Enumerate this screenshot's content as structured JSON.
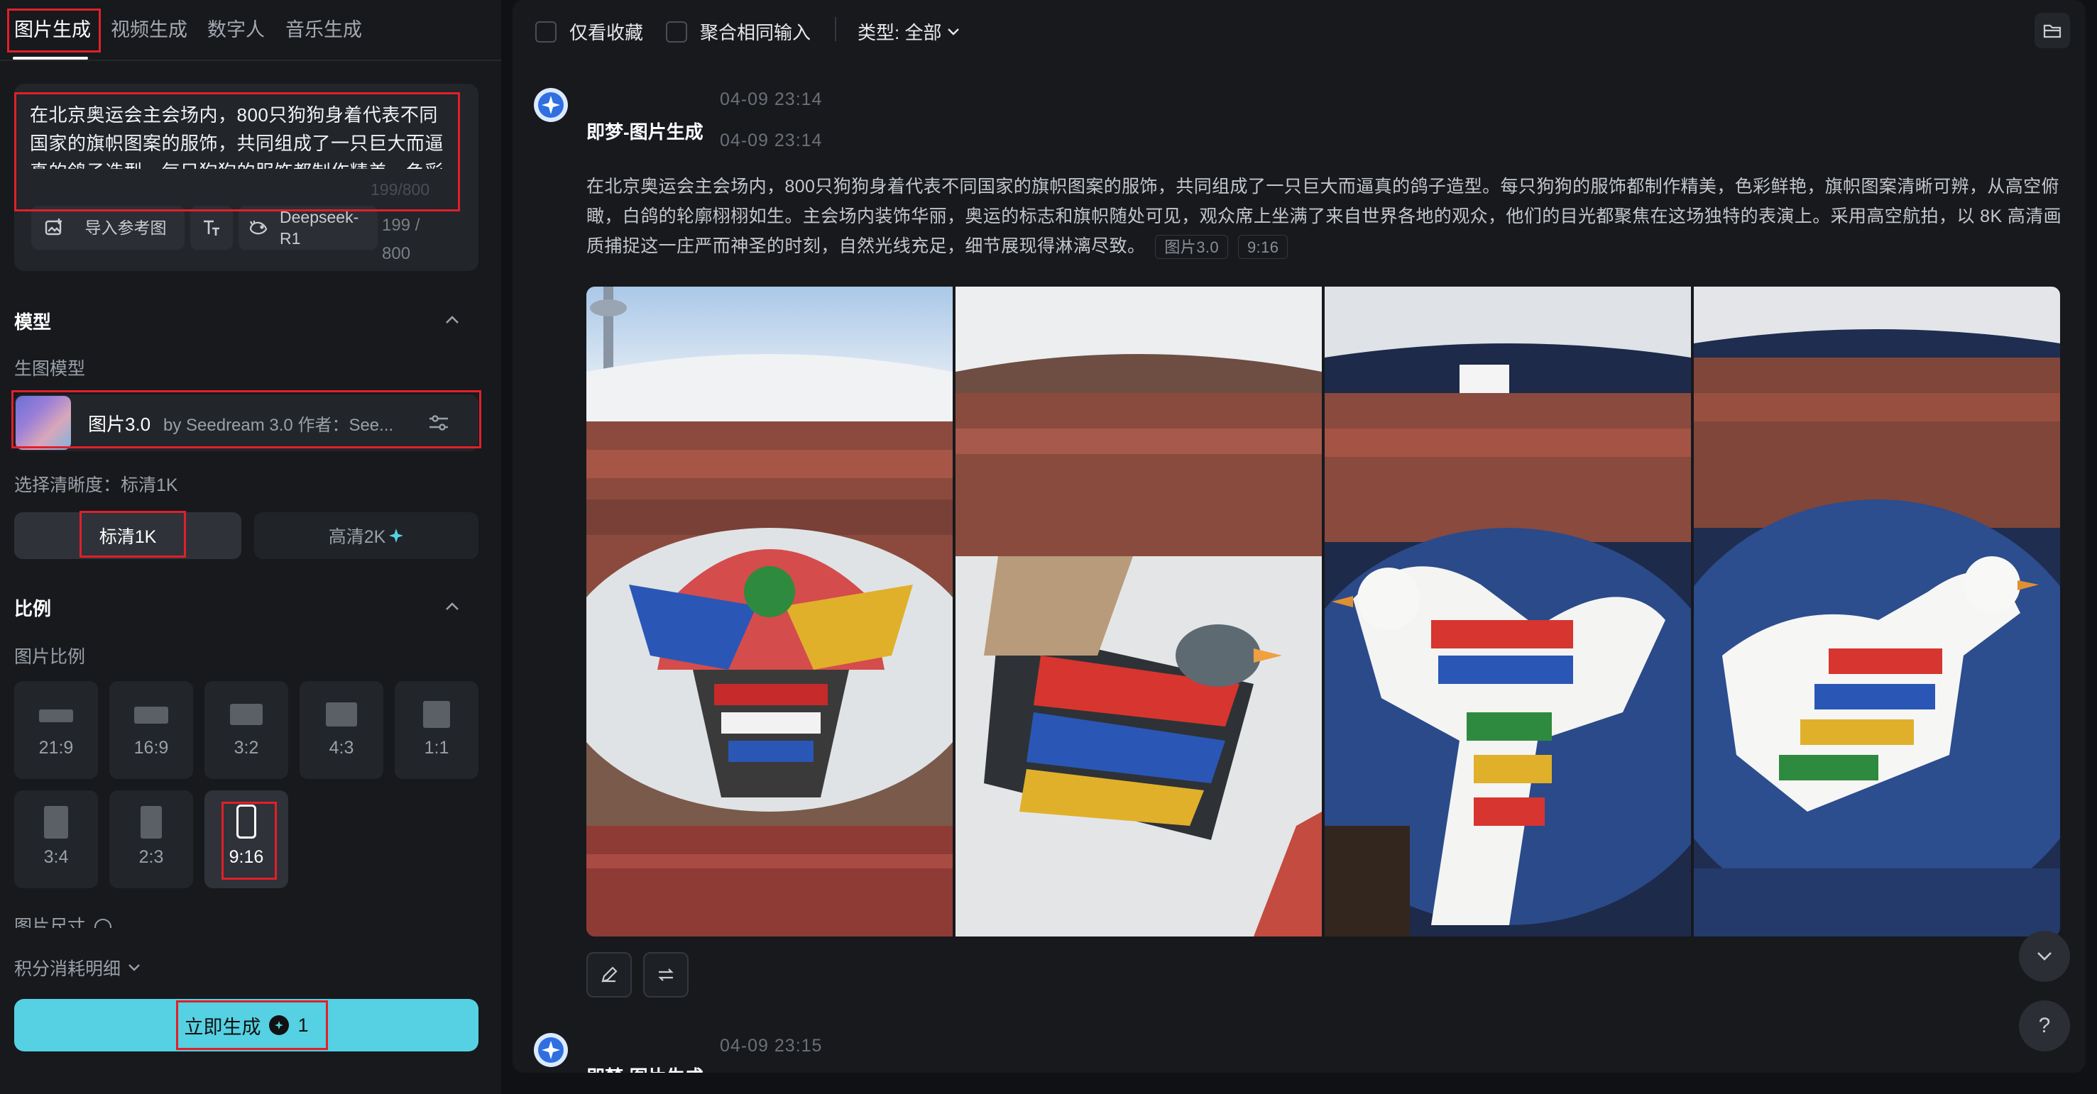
{
  "tabs": [
    {
      "label": "图片生成"
    },
    {
      "label": "视频生成"
    },
    {
      "label": "数字人"
    },
    {
      "label": "音乐生成"
    }
  ],
  "prompt": {
    "text": "在北京奥运会主会场内，800只狗狗身着代表不同国家的旗帜图案的服饰，共同组成了一只巨大而逼真的鸽子造型。每只狗狗的服饰都制作精美，色彩鲜艳，旗帜图案清晰可辨，从高空俯瞰，白鸽的",
    "count_ghost": "199/800",
    "count": "199 / 800",
    "ref_button": "导入参考图",
    "deepseek_button": "Deepseek-R1"
  },
  "model_section": {
    "title": "模型",
    "sub_label": "生图模型",
    "model_name": "图片3.0",
    "model_by": "by Seedream 3.0   作者：See..."
  },
  "quality": {
    "label": "选择清晰度：标清1K",
    "standard": "标清1K",
    "hd": "高清2K"
  },
  "ratio_section": {
    "title": "比例",
    "sub_label": "图片比例",
    "ratios": [
      "21:9",
      "16:9",
      "3:2",
      "4:3",
      "1:1",
      "3:4",
      "2:3",
      "9:16"
    ],
    "selected": "9:16",
    "size_label": "图片尺寸"
  },
  "points_label": "积分消耗明细",
  "generate": {
    "label": "立即生成",
    "cost": "1"
  },
  "topbar": {
    "favorites_only": "仅看收藏",
    "merge_same": "聚合相同输入",
    "type_filter": "类型: 全部"
  },
  "message": {
    "title": "即梦-图片生成",
    "time_a": "04-09  23:14",
    "time_b": "04-09  23:14",
    "body": "在北京奥运会主会场内，800只狗狗身着代表不同国家的旗帜图案的服饰，共同组成了一只巨大而逼真的鸽子造型。每只狗狗的服饰都制作精美，色彩鲜艳，旗帜图案清晰可辨，从高空俯瞰，白鸽的轮廓栩栩如生。主会场内装饰华丽，奥运的标志和旗帜随处可见，观众席上坐满了来自世界各地的观众，他们的目光都聚焦在这场独特的表演上。采用高空航拍，以 8K 高清画质捕捉这一庄严而神圣的时刻，自然光线充足，细节展现得淋漓尽致。",
    "tag_model": "图片3.0",
    "tag_ratio": "9:16"
  },
  "next_message": {
    "title": "即梦-图片生成",
    "time": "04-09  23:15"
  },
  "colors": {
    "accent": "#55d1e3",
    "highlight_box": "#e0202a",
    "panel": "#17191d",
    "background": "#0f1114"
  }
}
